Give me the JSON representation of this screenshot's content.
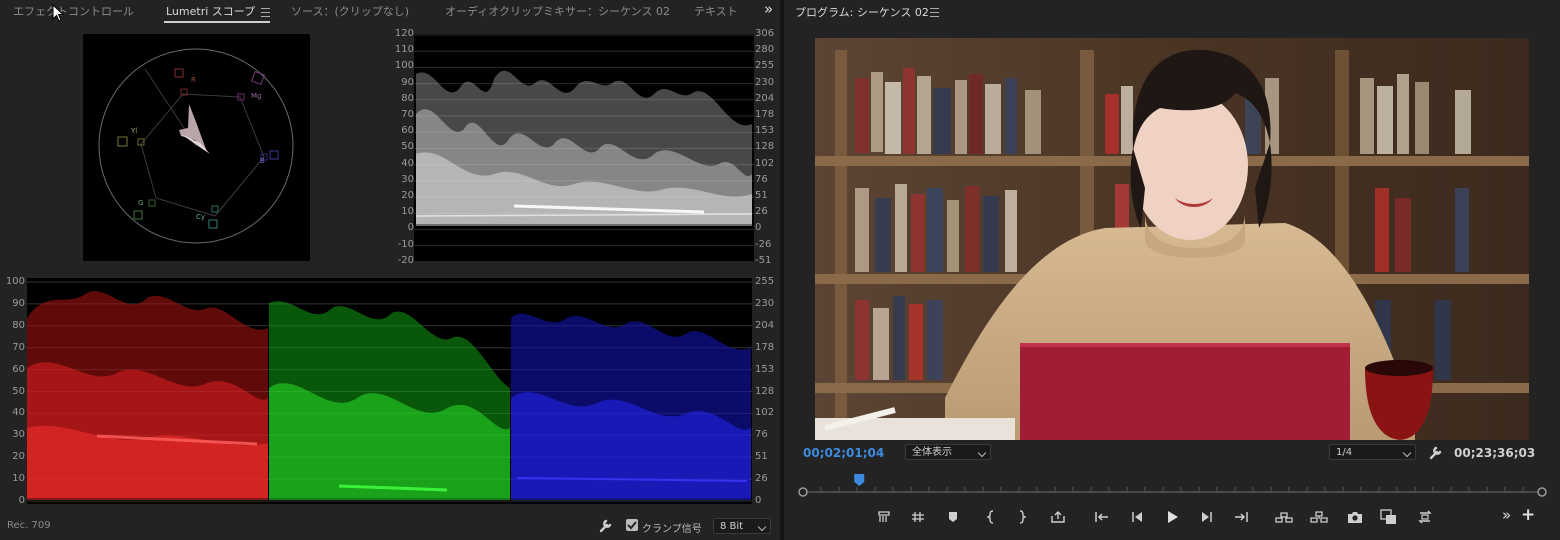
{
  "left_panel": {
    "tabs": [
      {
        "label": "エフェクトコントロール"
      },
      {
        "label": "Lumetri スコープ"
      },
      {
        "label": "ソース：(クリップなし)"
      },
      {
        "label": "オーディオクリップミキサー：シーケンス 02"
      },
      {
        "label": "テキスト"
      }
    ],
    "overflow_glyph": "»",
    "vectorscope_labels": {
      "r": "R",
      "mg": "Mg",
      "b": "B",
      "cy": "Cy",
      "g": "G",
      "yl": "Yl"
    },
    "waveform_left_ticks": [
      "120",
      "110",
      "100",
      "90",
      "80",
      "70",
      "60",
      "50",
      "40",
      "30",
      "20",
      "10",
      "0",
      "-10",
      "-20"
    ],
    "waveform_right_ticks": [
      "306",
      "280",
      "255",
      "230",
      "204",
      "178",
      "153",
      "128",
      "102",
      "76",
      "51",
      "26",
      "0",
      "-26",
      "-51"
    ],
    "parade_left_ticks": [
      "100",
      "90",
      "80",
      "70",
      "60",
      "50",
      "40",
      "30",
      "20",
      "10",
      "0"
    ],
    "parade_right_ticks": [
      "255",
      "230",
      "204",
      "178",
      "153",
      "128",
      "102",
      "76",
      "51",
      "26",
      "0"
    ],
    "footer": {
      "color_space": "Rec. 709",
      "clamp_label": "クランプ信号",
      "clamp_checked": true,
      "bit_depth": "8 Bit"
    }
  },
  "right_panel": {
    "title": "プログラム: シーケンス 02",
    "current_timecode": "00;02;01;04",
    "zoom_select": "全体表示",
    "resolution_select": "1/4",
    "duration_timecode": "00;23;36;03",
    "playhead_fraction": 0.076,
    "overflow_glyph": "»",
    "add_glyph": "+"
  },
  "colors": {
    "accent_blue": "#3d8be0",
    "panel_bg": "#232323",
    "scope_bg": "#000000"
  }
}
